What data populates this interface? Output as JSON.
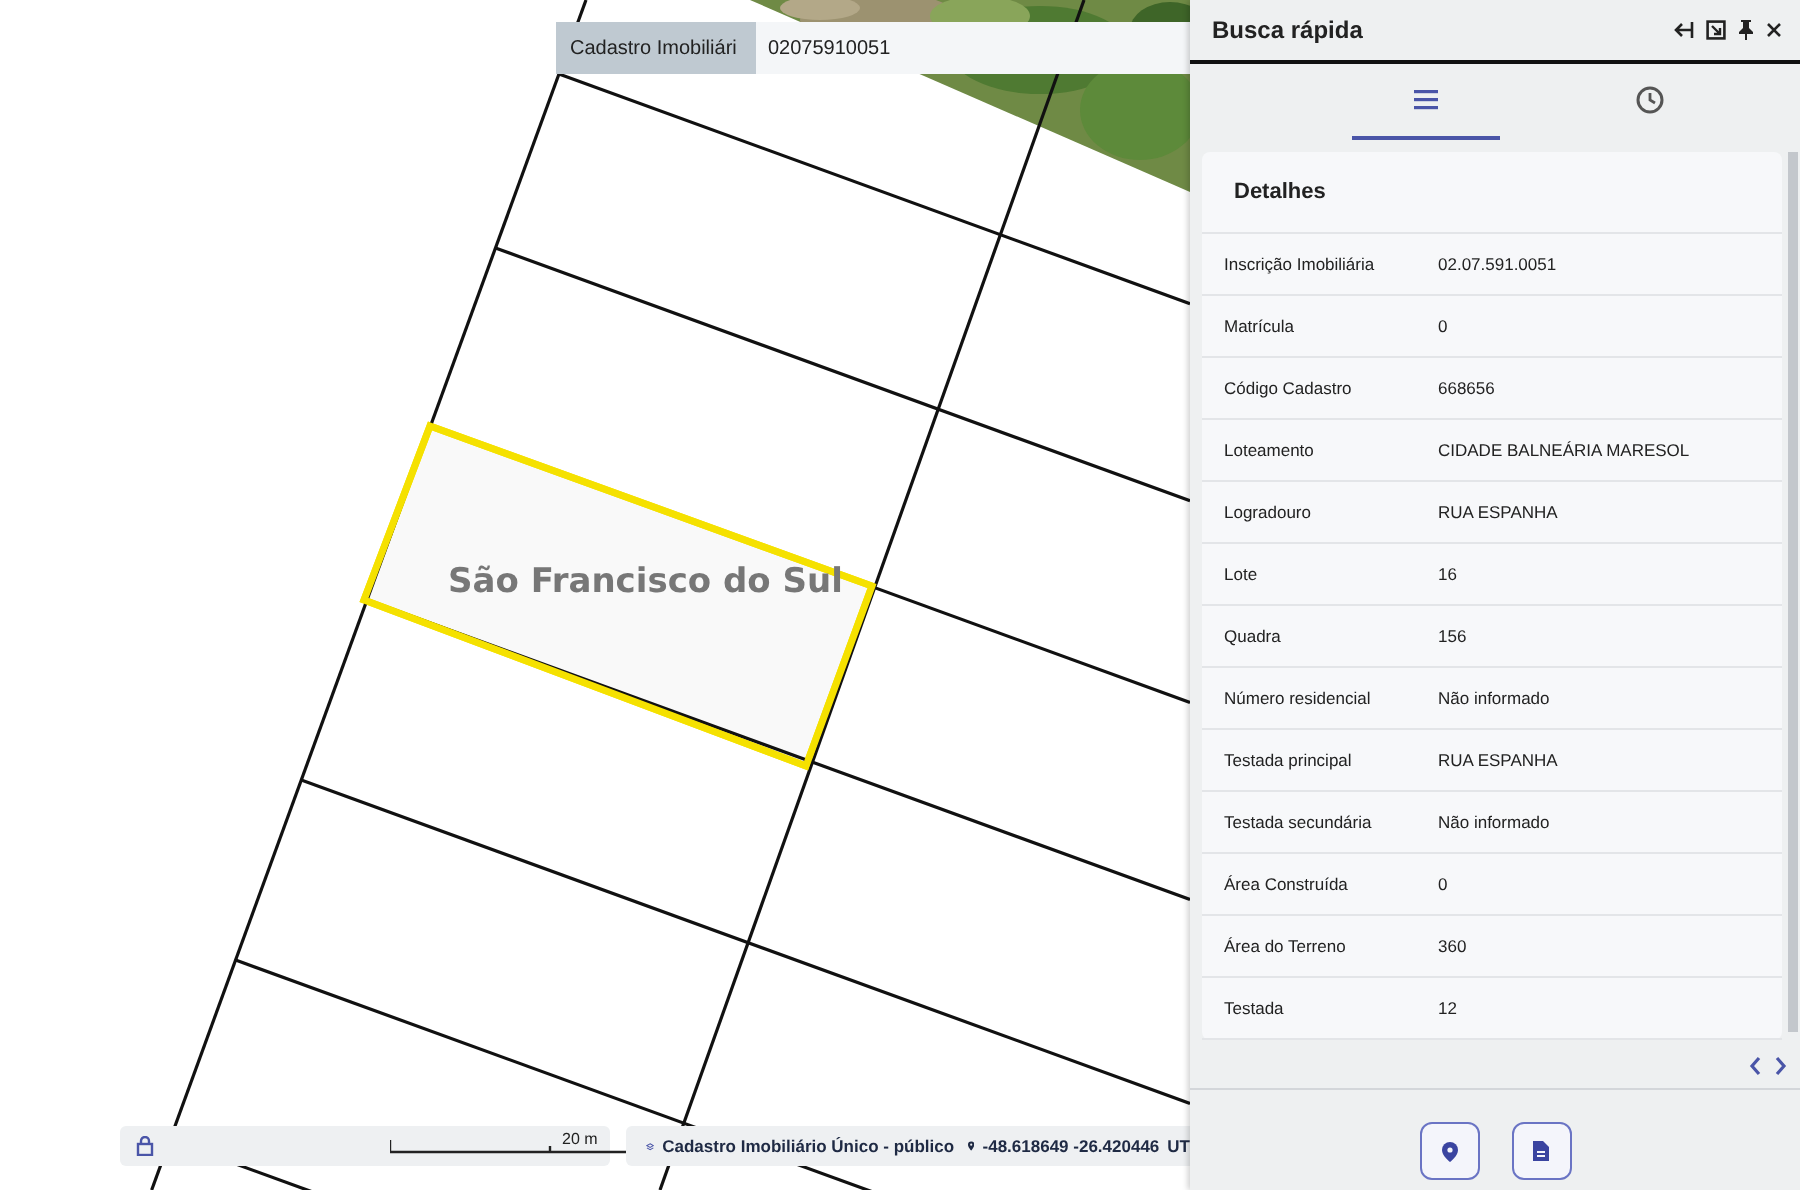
{
  "search": {
    "layer": "Cadastro Imobiliári",
    "value": "02075910051"
  },
  "map": {
    "label": "São Francisco do Sul",
    "scale": "20 m",
    "layer": "Cadastro Imobiliário Único - público",
    "coordinates": "-48.618649 -26.420446",
    "projection": "UT"
  },
  "panel": {
    "title": "Busca rápida",
    "tabs": [
      {
        "kind": "list",
        "selected": true
      },
      {
        "kind": "history",
        "selected": false
      }
    ],
    "section": "Detalhes",
    "rows": [
      {
        "label": "Inscrição Imobiliária",
        "value": "02.07.591.0051"
      },
      {
        "label": "Matrícula",
        "value": "0"
      },
      {
        "label": "Código Cadastro",
        "value": "668656"
      },
      {
        "label": "Loteamento",
        "value": "CIDADE BALNEÁRIA MARESOL"
      },
      {
        "label": "Logradouro",
        "value": "RUA ESPANHA"
      },
      {
        "label": "Lote",
        "value": "16"
      },
      {
        "label": "Quadra",
        "value": "156"
      },
      {
        "label": "Número residencial",
        "value": "Não informado"
      },
      {
        "label": "Testada principal",
        "value": "RUA ESPANHA"
      },
      {
        "label": "Testada secundária",
        "value": "Não informado"
      },
      {
        "label": "Área Construída",
        "value": "0"
      },
      {
        "label": "Área do Terreno",
        "value": "360"
      },
      {
        "label": "Testada",
        "value": "12"
      }
    ]
  }
}
